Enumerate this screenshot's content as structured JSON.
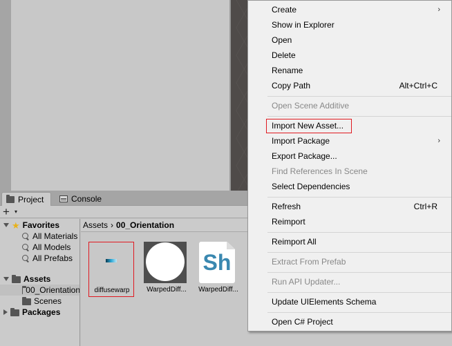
{
  "tabs": {
    "project": "Project",
    "console": "Console"
  },
  "toolbar": {
    "plus": "+",
    "caret": "▾"
  },
  "tree": {
    "favorites": "Favorites",
    "favorite_items": [
      "All Materials",
      "All Models",
      "All Prefabs"
    ],
    "assets": "Assets",
    "asset_children": [
      "00_Orientation",
      "Scenes"
    ],
    "packages": "Packages"
  },
  "breadcrumb": {
    "root": "Assets",
    "separator": "›",
    "current": "00_Orientation"
  },
  "assets_grid": [
    {
      "label": "diffusewarp"
    },
    {
      "label": "WarpedDiff..."
    },
    {
      "label": "WarpedDiff..."
    }
  ],
  "shader_thumb_text": "Sh",
  "context_menu": {
    "items": [
      {
        "label": "Create",
        "submenu": "›"
      },
      {
        "label": "Show in Explorer"
      },
      {
        "label": "Open"
      },
      {
        "label": "Delete"
      },
      {
        "label": "Rename"
      },
      {
        "label": "Copy Path",
        "shortcut": "Alt+Ctrl+C"
      },
      {
        "label": "Open Scene Additive"
      },
      {
        "label": "Import New Asset..."
      },
      {
        "label": "Import Package",
        "submenu": "›"
      },
      {
        "label": "Export Package..."
      },
      {
        "label": "Find References In Scene"
      },
      {
        "label": "Select Dependencies"
      },
      {
        "label": "Refresh",
        "shortcut": "Ctrl+R"
      },
      {
        "label": "Reimport"
      },
      {
        "label": "Reimport All"
      },
      {
        "label": "Extract From Prefab"
      },
      {
        "label": "Run API Updater..."
      },
      {
        "label": "Update UIElements Schema"
      },
      {
        "label": "Open C# Project"
      }
    ]
  },
  "colors": {
    "highlight": "#e0181f",
    "menu_bg": "#f0f0f0",
    "disabled_text": "#888888",
    "star": "#e8b21a"
  }
}
